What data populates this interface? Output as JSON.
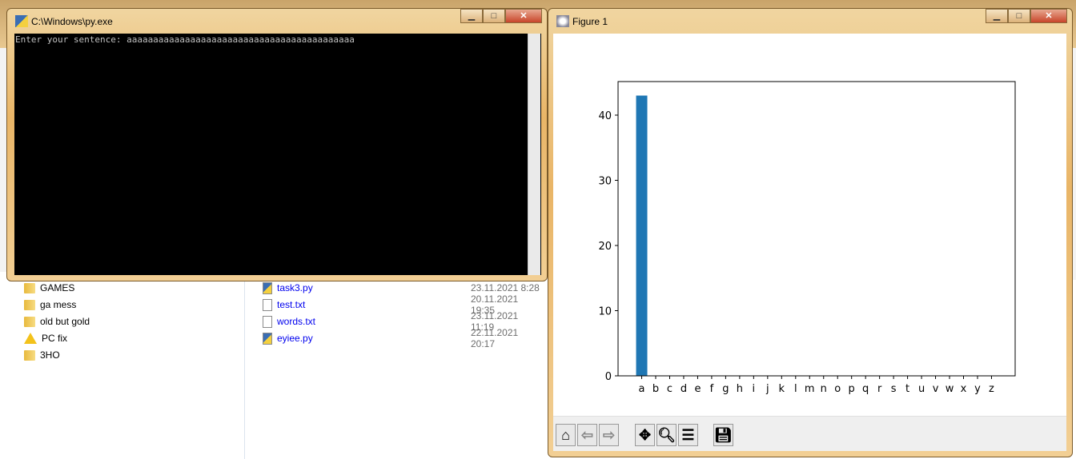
{
  "explorer": {
    "nav": [
      {
        "label": "GAMES",
        "icon": "folder-icon"
      },
      {
        "label": "ga mess",
        "icon": "folder-icon"
      },
      {
        "label": "old but gold",
        "icon": "folder-icon"
      },
      {
        "label": "PC fix",
        "icon": "warning-icon"
      },
      {
        "label": "3HO",
        "icon": "folder-icon"
      }
    ],
    "files": [
      {
        "name": "task3.py",
        "date": "23.11.2021 8:28",
        "icon": "python-file-icon"
      },
      {
        "name": "test.txt",
        "date": "20.11.2021 19:35",
        "icon": "text-file-icon"
      },
      {
        "name": "words.txt",
        "date": "23.11.2021 11:19",
        "icon": "text-file-icon"
      },
      {
        "name": "eyiee.py",
        "date": "22.11.2021 20:17",
        "icon": "python-file-icon"
      }
    ]
  },
  "console": {
    "title": "C:\\Windows\\py.exe",
    "text": "Enter your sentence: aaaaaaaaaaaaaaaaaaaaaaaaaaaaaaaaaaaaaaaaaaa"
  },
  "figure": {
    "title": "Figure 1"
  },
  "chart_data": {
    "type": "bar",
    "title": "",
    "xlabel": "",
    "ylabel": "",
    "categories": [
      "a",
      "b",
      "c",
      "d",
      "e",
      "f",
      "g",
      "h",
      "i",
      "j",
      "k",
      "l",
      "m",
      "n",
      "o",
      "p",
      "q",
      "r",
      "s",
      "t",
      "u",
      "v",
      "w",
      "x",
      "y",
      "z"
    ],
    "values": [
      43,
      0,
      0,
      0,
      0,
      0,
      0,
      0,
      0,
      0,
      0,
      0,
      0,
      0,
      0,
      0,
      0,
      0,
      0,
      0,
      0,
      0,
      0,
      0,
      0,
      0
    ],
    "yticks": [
      0,
      10,
      20,
      30,
      40
    ],
    "ylim": [
      0,
      45.15
    ],
    "color": "#1f77b4",
    "grid": false
  }
}
